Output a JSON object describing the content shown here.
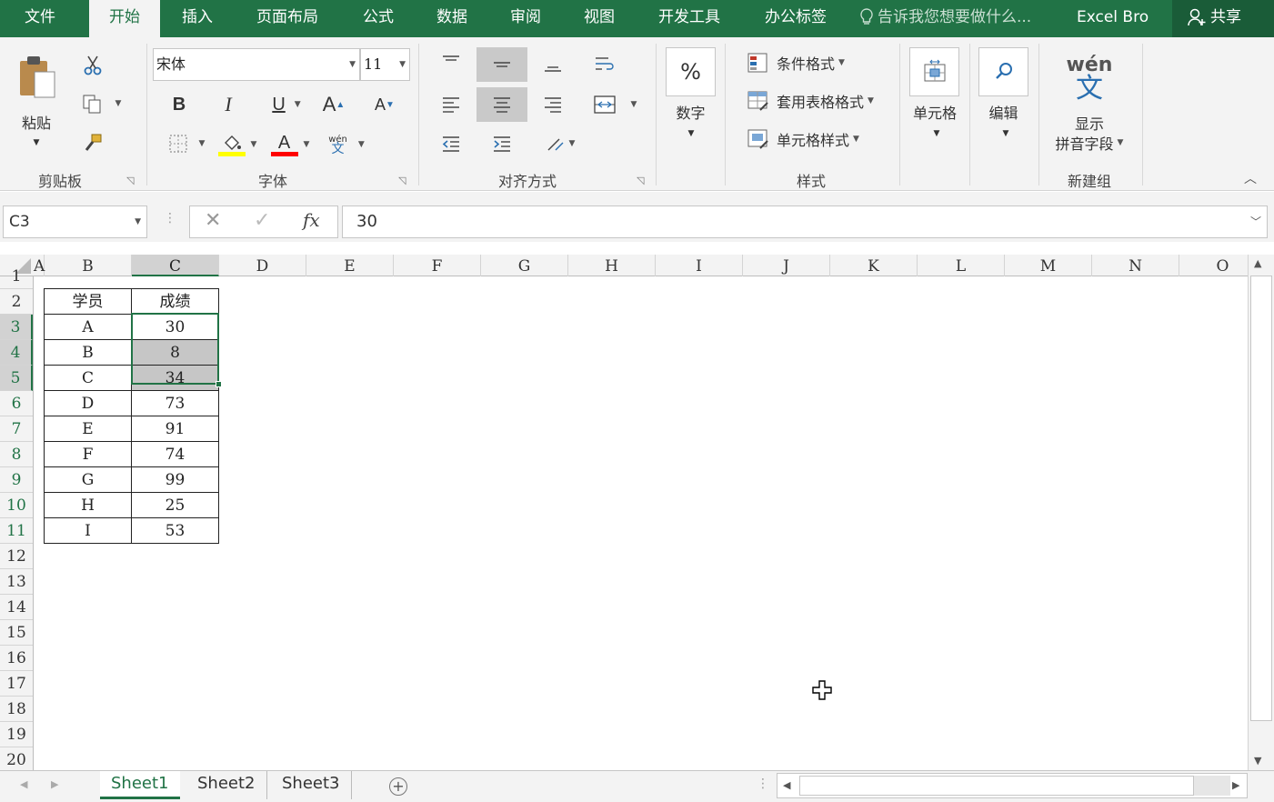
{
  "ribbon_tabs": [
    "文件",
    "开始",
    "插入",
    "页面布局",
    "公式",
    "数据",
    "审阅",
    "视图",
    "开发工具",
    "办公标签"
  ],
  "tell_me": "告诉我您想要做什么...",
  "user_name": "Excel Bro",
  "share_label": "共享",
  "clipboard": {
    "paste": "粘贴",
    "group": "剪贴板"
  },
  "font": {
    "name": "宋体",
    "size": "11",
    "bold": "B",
    "italic": "I",
    "underline": "U",
    "grow": "A",
    "shrink": "A",
    "font_color_glyph": "A",
    "phonetic_top": "wén",
    "phonetic_bottom": "文",
    "group": "字体",
    "fill_color": "#ffff00",
    "text_color": "#ff0000"
  },
  "alignment": {
    "group": "对齐方式"
  },
  "number": {
    "symbol": "%",
    "label": "数字"
  },
  "styles": {
    "conditional": "条件格式",
    "table": "套用表格格式",
    "cell": "单元格样式",
    "group": "样式"
  },
  "cells_group": {
    "label": "单元格"
  },
  "editing": {
    "label": "编辑"
  },
  "new_group": {
    "wen": "wén",
    "wen_char": "文",
    "show": "显示",
    "field": "拼音字段",
    "group": "新建组"
  },
  "name_box": "C3",
  "formula_value": "30",
  "fx": "fx",
  "columns": [
    "A",
    "B",
    "C",
    "D",
    "E",
    "F",
    "G",
    "H",
    "I",
    "J",
    "K",
    "L",
    "M",
    "N",
    "O"
  ],
  "rows": [
    "1",
    "2",
    "3",
    "4",
    "5",
    "6",
    "7",
    "8",
    "9",
    "10",
    "11",
    "12",
    "13",
    "14",
    "15",
    "16",
    "17",
    "18",
    "19",
    "20"
  ],
  "table": {
    "headers": [
      "学员",
      "成绩"
    ],
    "rows": [
      [
        "A",
        "30"
      ],
      [
        "B",
        "8"
      ],
      [
        "C",
        "34"
      ],
      [
        "D",
        "73"
      ],
      [
        "E",
        "91"
      ],
      [
        "F",
        "74"
      ],
      [
        "G",
        "99"
      ],
      [
        "H",
        "25"
      ],
      [
        "I",
        "53"
      ]
    ]
  },
  "sheets": [
    "Sheet1",
    "Sheet2",
    "Sheet3"
  ],
  "accent": "#217346"
}
